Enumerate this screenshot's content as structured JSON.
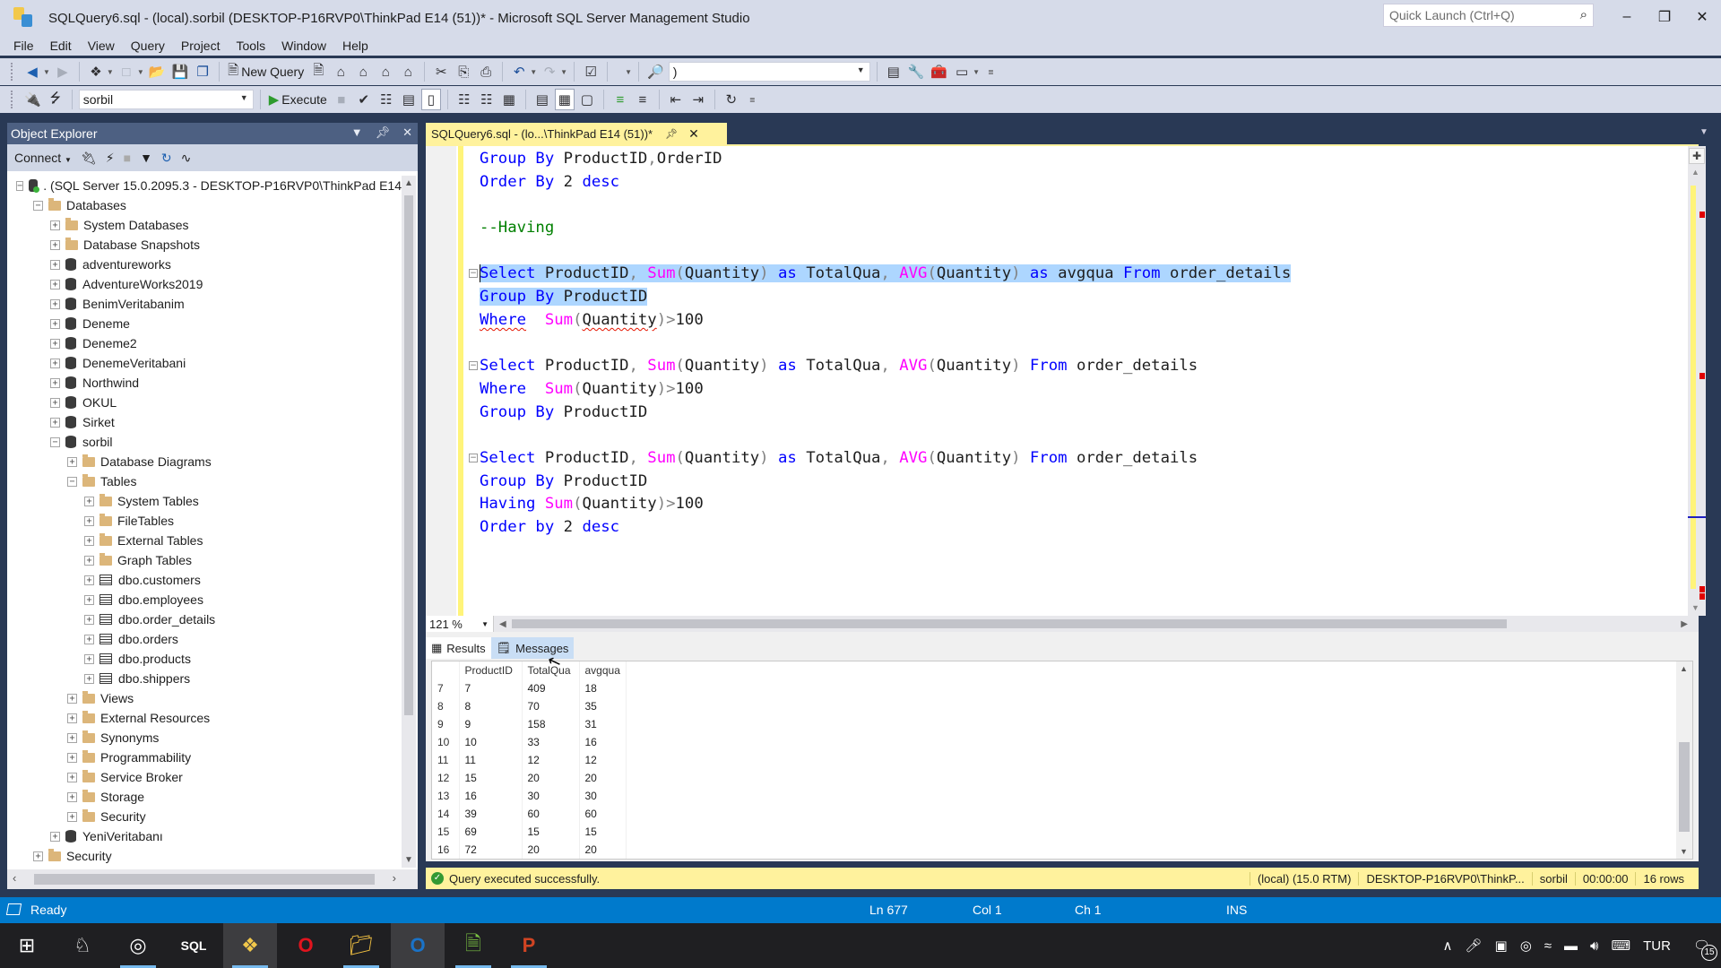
{
  "window": {
    "title": "SQLQuery6.sql - (local).sorbil (DESKTOP-P16RVP0\\ThinkPad E14 (51))* - Microsoft SQL Server Management Studio",
    "quick_launch_placeholder": "Quick Launch (Ctrl+Q)",
    "minimize": "–",
    "restore": "❐",
    "close": "✕"
  },
  "menu": [
    "File",
    "Edit",
    "View",
    "Query",
    "Project",
    "Tools",
    "Window",
    "Help"
  ],
  "toolbar": {
    "new_query_label": "New Query",
    "database_selected": "sorbil",
    "solution_config_value": ")",
    "execute_label": "Execute"
  },
  "object_explorer": {
    "title": "Object Explorer",
    "connect_label": "Connect",
    "tree": [
      {
        "level": 0,
        "expander": "-",
        "icon": "server",
        "label": ". (SQL Server 15.0.2095.3 - DESKTOP-P16RVP0\\ThinkPad E14"
      },
      {
        "level": 1,
        "expander": "-",
        "icon": "folder",
        "label": "Databases"
      },
      {
        "level": 2,
        "expander": "+",
        "icon": "folder",
        "label": "System Databases"
      },
      {
        "level": 2,
        "expander": "+",
        "icon": "folder",
        "label": "Database Snapshots"
      },
      {
        "level": 2,
        "expander": "+",
        "icon": "db",
        "label": "adventureworks"
      },
      {
        "level": 2,
        "expander": "+",
        "icon": "db",
        "label": "AdventureWorks2019"
      },
      {
        "level": 2,
        "expander": "+",
        "icon": "db",
        "label": "BenimVeritabanim"
      },
      {
        "level": 2,
        "expander": "+",
        "icon": "db",
        "label": "Deneme"
      },
      {
        "level": 2,
        "expander": "+",
        "icon": "db",
        "label": "Deneme2"
      },
      {
        "level": 2,
        "expander": "+",
        "icon": "db",
        "label": "DenemeVeritabani"
      },
      {
        "level": 2,
        "expander": "+",
        "icon": "db",
        "label": "Northwind"
      },
      {
        "level": 2,
        "expander": "+",
        "icon": "db",
        "label": "OKUL"
      },
      {
        "level": 2,
        "expander": "+",
        "icon": "db",
        "label": "Sirket"
      },
      {
        "level": 2,
        "expander": "-",
        "icon": "db",
        "label": "sorbil"
      },
      {
        "level": 3,
        "expander": "+",
        "icon": "folder",
        "label": "Database Diagrams"
      },
      {
        "level": 3,
        "expander": "-",
        "icon": "folder",
        "label": "Tables"
      },
      {
        "level": 4,
        "expander": "+",
        "icon": "folder",
        "label": "System Tables"
      },
      {
        "level": 4,
        "expander": "+",
        "icon": "folder",
        "label": "FileTables"
      },
      {
        "level": 4,
        "expander": "+",
        "icon": "folder",
        "label": "External Tables"
      },
      {
        "level": 4,
        "expander": "+",
        "icon": "folder",
        "label": "Graph Tables"
      },
      {
        "level": 4,
        "expander": "+",
        "icon": "table",
        "label": "dbo.customers"
      },
      {
        "level": 4,
        "expander": "+",
        "icon": "table",
        "label": "dbo.employees"
      },
      {
        "level": 4,
        "expander": "+",
        "icon": "table",
        "label": "dbo.order_details"
      },
      {
        "level": 4,
        "expander": "+",
        "icon": "table",
        "label": "dbo.orders"
      },
      {
        "level": 4,
        "expander": "+",
        "icon": "table",
        "label": "dbo.products"
      },
      {
        "level": 4,
        "expander": "+",
        "icon": "table",
        "label": "dbo.shippers"
      },
      {
        "level": 3,
        "expander": "+",
        "icon": "folder",
        "label": "Views"
      },
      {
        "level": 3,
        "expander": "+",
        "icon": "folder",
        "label": "External Resources"
      },
      {
        "level": 3,
        "expander": "+",
        "icon": "folder",
        "label": "Synonyms"
      },
      {
        "level": 3,
        "expander": "+",
        "icon": "folder",
        "label": "Programmability"
      },
      {
        "level": 3,
        "expander": "+",
        "icon": "folder",
        "label": "Service Broker"
      },
      {
        "level": 3,
        "expander": "+",
        "icon": "folder",
        "label": "Storage"
      },
      {
        "level": 3,
        "expander": "+",
        "icon": "folder",
        "label": "Security"
      },
      {
        "level": 2,
        "expander": "+",
        "icon": "db",
        "label": "YeniVeritabanı"
      },
      {
        "level": 1,
        "expander": "+",
        "icon": "folder",
        "label": "Security"
      }
    ]
  },
  "editor": {
    "tab_label": "SQLQuery6.sql - (lo...\\ThinkPad E14 (51))*",
    "zoom": "121 %",
    "lines": [
      {
        "tokens": [
          [
            "kw",
            "Group By "
          ],
          [
            "id",
            "ProductID"
          ],
          [
            "op",
            ","
          ],
          [
            "id",
            "OrderID"
          ]
        ]
      },
      {
        "tokens": [
          [
            "kw",
            "Order By "
          ],
          [
            "id",
            "2 "
          ],
          [
            "kw",
            "desc"
          ]
        ]
      },
      {
        "tokens": []
      },
      {
        "tokens": [
          [
            "cm",
            "--Having"
          ]
        ]
      },
      {
        "tokens": []
      },
      {
        "fold": true,
        "selected": true,
        "caret": true,
        "tokens": [
          [
            "kw",
            "Select "
          ],
          [
            "id",
            "ProductID"
          ],
          [
            "op",
            ", "
          ],
          [
            "fn",
            "Sum"
          ],
          [
            "op",
            "("
          ],
          [
            "id",
            "Quantity"
          ],
          [
            "op",
            ") "
          ],
          [
            "kw",
            "as "
          ],
          [
            "id",
            "TotalQua"
          ],
          [
            "op",
            ", "
          ],
          [
            "fn",
            "AVG"
          ],
          [
            "op",
            "("
          ],
          [
            "id",
            "Quantity"
          ],
          [
            "op",
            ") "
          ],
          [
            "kw",
            "as "
          ],
          [
            "id",
            "avgqua "
          ],
          [
            "kw",
            "From "
          ],
          [
            "id",
            "order_details"
          ]
        ]
      },
      {
        "selected": true,
        "tokens": [
          [
            "kw",
            "Group By "
          ],
          [
            "id",
            "ProductID"
          ]
        ]
      },
      {
        "tokens": [
          [
            "kw squig",
            "Where"
          ],
          [
            "id",
            "  "
          ],
          [
            "fn",
            "Sum"
          ],
          [
            "op",
            "("
          ],
          [
            "id squig",
            "Quantity"
          ],
          [
            "op",
            ")>"
          ],
          [
            "id",
            "100"
          ]
        ]
      },
      {
        "tokens": []
      },
      {
        "fold": true,
        "tokens": [
          [
            "kw",
            "Select "
          ],
          [
            "id",
            "ProductID"
          ],
          [
            "op",
            ", "
          ],
          [
            "fn",
            "Sum"
          ],
          [
            "op",
            "("
          ],
          [
            "id",
            "Quantity"
          ],
          [
            "op",
            ") "
          ],
          [
            "kw",
            "as "
          ],
          [
            "id",
            "TotalQua"
          ],
          [
            "op",
            ", "
          ],
          [
            "fn",
            "AVG"
          ],
          [
            "op",
            "("
          ],
          [
            "id",
            "Quantity"
          ],
          [
            "op",
            ") "
          ],
          [
            "kw",
            "From "
          ],
          [
            "id",
            "order_details"
          ]
        ]
      },
      {
        "tokens": [
          [
            "kw",
            "Where"
          ],
          [
            "id",
            "  "
          ],
          [
            "fn",
            "Sum"
          ],
          [
            "op",
            "("
          ],
          [
            "id",
            "Quantity"
          ],
          [
            "op",
            ")>"
          ],
          [
            "id",
            "100"
          ]
        ]
      },
      {
        "tokens": [
          [
            "kw",
            "Group By "
          ],
          [
            "id",
            "ProductID"
          ]
        ]
      },
      {
        "tokens": []
      },
      {
        "fold": true,
        "tokens": [
          [
            "kw",
            "Select "
          ],
          [
            "id",
            "ProductID"
          ],
          [
            "op",
            ", "
          ],
          [
            "fn",
            "Sum"
          ],
          [
            "op",
            "("
          ],
          [
            "id",
            "Quantity"
          ],
          [
            "op",
            ") "
          ],
          [
            "kw",
            "as "
          ],
          [
            "id",
            "TotalQua"
          ],
          [
            "op",
            ", "
          ],
          [
            "fn",
            "AVG"
          ],
          [
            "op",
            "("
          ],
          [
            "id",
            "Quantity"
          ],
          [
            "op",
            ") "
          ],
          [
            "kw",
            "From "
          ],
          [
            "id",
            "order_details"
          ]
        ]
      },
      {
        "tokens": [
          [
            "kw",
            "Group By "
          ],
          [
            "id",
            "ProductID"
          ]
        ]
      },
      {
        "tokens": [
          [
            "kw",
            "Having "
          ],
          [
            "fn",
            "Sum"
          ],
          [
            "op",
            "("
          ],
          [
            "id",
            "Quantity"
          ],
          [
            "op",
            ")>"
          ],
          [
            "id",
            "100"
          ]
        ]
      },
      {
        "tokens": [
          [
            "kw",
            "Order by "
          ],
          [
            "id",
            "2 "
          ],
          [
            "kw",
            "desc"
          ]
        ]
      }
    ]
  },
  "results": {
    "tabs": {
      "results": "Results",
      "messages": "Messages"
    },
    "columns": [
      "",
      "ProductID",
      "TotalQua",
      "avgqua"
    ],
    "rows": [
      [
        "7",
        "7",
        "409",
        "18"
      ],
      [
        "8",
        "8",
        "70",
        "35"
      ],
      [
        "9",
        "9",
        "158",
        "31"
      ],
      [
        "10",
        "10",
        "33",
        "16"
      ],
      [
        "11",
        "11",
        "12",
        "12"
      ],
      [
        "12",
        "15",
        "20",
        "20"
      ],
      [
        "13",
        "16",
        "30",
        "30"
      ],
      [
        "14",
        "39",
        "60",
        "60"
      ],
      [
        "15",
        "69",
        "15",
        "15"
      ],
      [
        "16",
        "72",
        "20",
        "20"
      ]
    ]
  },
  "query_status": {
    "message": "Query executed successfully.",
    "server": "(local) (15.0 RTM)",
    "login": "DESKTOP-P16RVP0\\ThinkP...",
    "database": "sorbil",
    "elapsed": "00:00:00",
    "rows": "16 rows"
  },
  "status_bar": {
    "state": "Ready",
    "line": "Ln 677",
    "col": "Col 1",
    "ch": "Ch 1",
    "mode": "INS"
  },
  "taskbar": {
    "apps": [
      "start",
      "app-2",
      "obs",
      "sql-tool",
      "ssms",
      "opera",
      "file-explorer",
      "outlook",
      "notepad-plus",
      "powerpoint"
    ],
    "language": "TUR",
    "notification_count": "15"
  },
  "colors": {
    "accent": "#007acc",
    "keyword": "#0000ff",
    "function": "#ff00ff",
    "comment": "#008000",
    "selection": "#add6ff",
    "tab_active": "#fff29d"
  }
}
